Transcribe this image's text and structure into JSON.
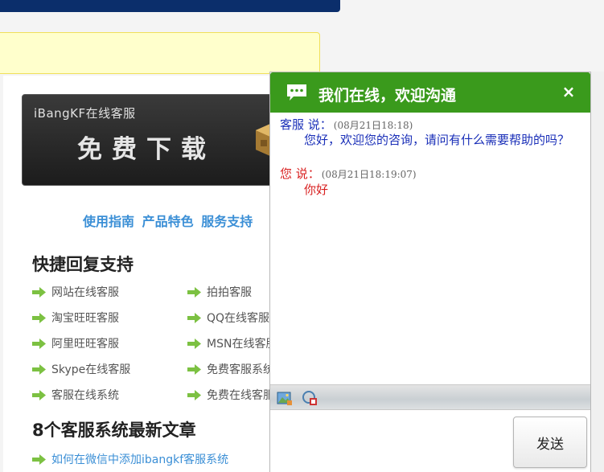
{
  "banner": {
    "small_text": "iBangKF在线客服",
    "big_text": "免费下载"
  },
  "links": [
    "使用指南",
    "产品特色",
    "服务支持"
  ],
  "section1": {
    "title": "快捷回复支持",
    "left_items": [
      "网站在线客服",
      "淘宝旺旺客服",
      "阿里旺旺客服",
      "Skype在线客服",
      "客服在线系统"
    ],
    "right_items": [
      "拍拍客服",
      "QQ在线客服",
      "MSN在线客服",
      "免费客服系统",
      "免费在线客服"
    ]
  },
  "section2": {
    "title": "8个客服系统最新文章",
    "items": [
      "如何在微信中添加ibangkf客服系统"
    ]
  },
  "chat": {
    "title": "我们在线，欢迎沟通",
    "close_label": "×",
    "messages": [
      {
        "sender": "客服 说：",
        "time": "(08月21日18:18)",
        "text": "您好，欢迎您的咨询，请问有什么需要帮助的吗？"
      },
      {
        "sender": "您 说：",
        "time": "(08月21日18:19:07)",
        "text": "你好"
      }
    ],
    "input_value": "",
    "send_label": "发送"
  },
  "colors": {
    "header_green": "#3a9a1c",
    "agent_blue": "#1a2fb8",
    "user_red": "#d81f1f",
    "link_blue": "#3b8fd6"
  }
}
